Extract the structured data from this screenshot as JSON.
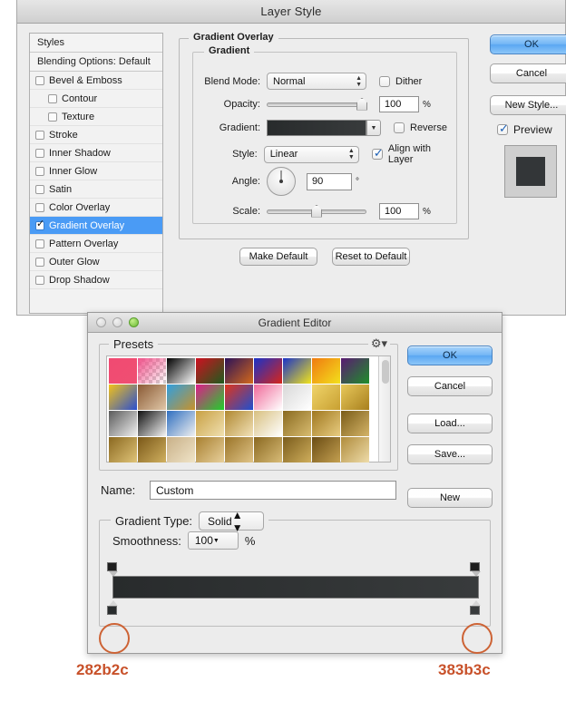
{
  "layer_style": {
    "title": "Layer Style",
    "styles_panel": {
      "header": "Styles",
      "blending_options": "Blending Options: Default",
      "items": [
        {
          "label": "Bevel & Emboss",
          "checked": false,
          "indent": false,
          "selected": false
        },
        {
          "label": "Contour",
          "checked": false,
          "indent": true,
          "selected": false
        },
        {
          "label": "Texture",
          "checked": false,
          "indent": true,
          "selected": false
        },
        {
          "label": "Stroke",
          "checked": false,
          "indent": false,
          "selected": false
        },
        {
          "label": "Inner Shadow",
          "checked": false,
          "indent": false,
          "selected": false
        },
        {
          "label": "Inner Glow",
          "checked": false,
          "indent": false,
          "selected": false
        },
        {
          "label": "Satin",
          "checked": false,
          "indent": false,
          "selected": false
        },
        {
          "label": "Color Overlay",
          "checked": false,
          "indent": false,
          "selected": false
        },
        {
          "label": "Gradient Overlay",
          "checked": true,
          "indent": false,
          "selected": true
        },
        {
          "label": "Pattern Overlay",
          "checked": false,
          "indent": false,
          "selected": false
        },
        {
          "label": "Outer Glow",
          "checked": false,
          "indent": false,
          "selected": false
        },
        {
          "label": "Drop Shadow",
          "checked": false,
          "indent": false,
          "selected": false
        }
      ]
    },
    "gradient_overlay": {
      "group_title": "Gradient Overlay",
      "gradient_group_title": "Gradient",
      "blend_mode_label": "Blend Mode:",
      "blend_mode_value": "Normal",
      "dither_label": "Dither",
      "dither_checked": false,
      "opacity_label": "Opacity:",
      "opacity_value": "100",
      "opacity_unit": "%",
      "gradient_label": "Gradient:",
      "gradient_start": "#282b2c",
      "gradient_end": "#383b3c",
      "reverse_label": "Reverse",
      "reverse_checked": false,
      "style_label": "Style:",
      "style_value": "Linear",
      "align_label": "Align with Layer",
      "align_checked": true,
      "angle_label": "Angle:",
      "angle_value": "90",
      "angle_unit": "°",
      "scale_label": "Scale:",
      "scale_value": "100",
      "scale_unit": "%",
      "make_default": "Make Default",
      "reset_to_default": "Reset to Default"
    },
    "buttons": {
      "ok": "OK",
      "cancel": "Cancel",
      "new_style": "New Style...",
      "preview_label": "Preview",
      "preview_checked": true,
      "preview_color": "#333638"
    }
  },
  "gradient_editor": {
    "title": "Gradient Editor",
    "presets": {
      "legend": "Presets",
      "gear_icon": "gear-icon",
      "swatches": [
        "linear-gradient(135deg,#f04a72,#ef4f72)",
        "linear-gradient(135deg,#f0528a,rgba(240,82,138,0))",
        "linear-gradient(135deg,#000000,#ffffff)",
        "linear-gradient(135deg,#cf1020,#1d5c1d)",
        "linear-gradient(135deg,#2b1259,#d4691a)",
        "linear-gradient(135deg,#1932c8,#d8251a)",
        "linear-gradient(135deg,#1a33c8,#f2e41b)",
        "linear-gradient(135deg,#f07b10,#f3e01c)",
        "linear-gradient(135deg,#5a1a72,#1f8f2a)",
        "linear-gradient(135deg,#f2c21a,#2a4fd0)",
        "linear-gradient(135deg,#8a5a34,#e0c7a8)",
        "linear-gradient(135deg,#2f9fe0,#c8922a)",
        "linear-gradient(135deg,#e01a8a,#1fd02a)",
        "linear-gradient(135deg,#e0341a,#1f4fd0)",
        "linear-gradient(135deg,#f06a9a,#ffffff)",
        "linear-gradient(135deg,#d8d8d8,#ffffff)",
        "linear-gradient(135deg,#f0d469,#c8a032)",
        "linear-gradient(135deg,#e8c85a,#a8801e)",
        "linear-gradient(135deg,#5a5a5a,#f0f0f0)",
        "linear-gradient(135deg,#101010,#f5f5f5)",
        "linear-gradient(135deg,#2f6fc0,#f0f0f0)",
        "linear-gradient(135deg,#c8a044,#f0e0b0)",
        "linear-gradient(135deg,#b08830,#f2e2b8)",
        "linear-gradient(135deg,#d8c080,#ffffff)",
        "linear-gradient(135deg,#8a6a20,#d8bc70)",
        "linear-gradient(135deg,#a07820,#e8cc80)",
        "linear-gradient(135deg,#7a5c18,#d4b468)",
        "linear-gradient(135deg,#8a6820,#e0c478)",
        "linear-gradient(135deg,#7a5818,#d0b060)",
        "linear-gradient(135deg,#c8b088,#f0e4c8)",
        "linear-gradient(135deg,#a88030,#e8d09c)",
        "linear-gradient(135deg,#9a7428,#e0c488)",
        "linear-gradient(135deg,#8a6820,#d8bc78)",
        "linear-gradient(135deg,#7a5c1c,#cfae5c)",
        "linear-gradient(135deg,#6a4c14,#c4a050)",
        "linear-gradient(135deg,#b08c3c,#eedcaa)"
      ]
    },
    "buttons": {
      "ok": "OK",
      "cancel": "Cancel",
      "load": "Load...",
      "save": "Save...",
      "new": "New"
    },
    "name_label": "Name:",
    "name_value": "Custom",
    "gradient_type_label": "Gradient Type:",
    "gradient_type_value": "Solid",
    "smoothness_label": "Smoothness:",
    "smoothness_value": "100",
    "smoothness_unit": "%",
    "strip": {
      "start_color": "#282b2c",
      "end_color": "#383b3c",
      "opacity_stop_color": "#1e1e1e"
    }
  },
  "annotations": {
    "left_hex": "282b2c",
    "right_hex": "383b3c",
    "color": "#c8512a"
  }
}
